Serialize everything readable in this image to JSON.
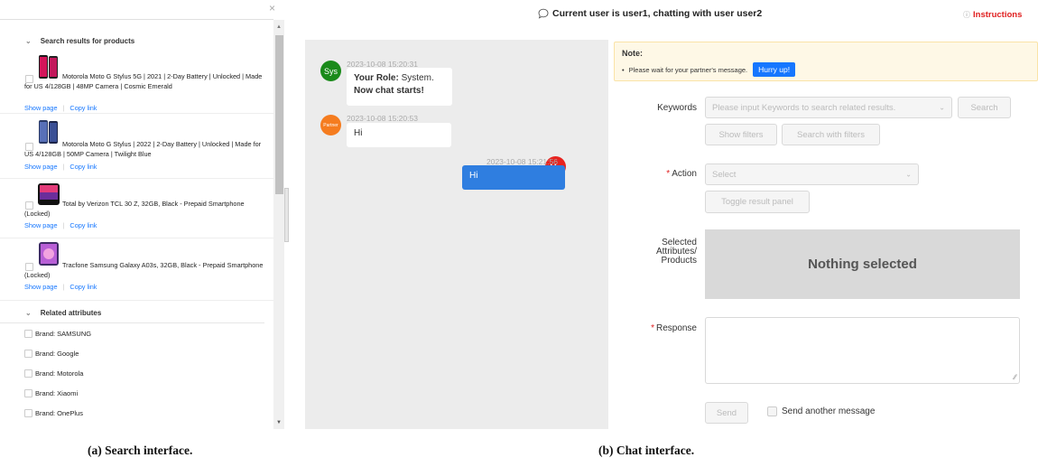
{
  "left": {
    "close_glyph": "×",
    "section_products": "Search results for products",
    "products": [
      {
        "title": "Motorola Moto G Stylus 5G | 2021 | 2-Day Battery | Unlocked | Made for US 4/128GB | 48MP Camera | Cosmic Emerald",
        "show": "Show page",
        "copy": "Copy link"
      },
      {
        "title": "Motorola Moto G Stylus | 2022 | 2-Day Battery | Unlocked | Made for US 4/128GB | 50MP Camera | Twilight Blue",
        "show": "Show page",
        "copy": "Copy link"
      },
      {
        "title": "Total by Verizon TCL 30 Z, 32GB, Black - Prepaid Smartphone (Locked)",
        "show": "Show page",
        "copy": "Copy link"
      },
      {
        "title": "Tracfone Samsung Galaxy A03s, 32GB, Black - Prepaid Smartphone (Locked)",
        "show": "Show page",
        "copy": "Copy link"
      }
    ],
    "section_attributes": "Related attributes",
    "attributes": [
      "Brand: SAMSUNG",
      "Brand: Google",
      "Brand: Motorola",
      "Brand: Xiaomi",
      "Brand: OnePlus"
    ]
  },
  "header": {
    "title": "Current user is user1, chatting with user user2",
    "instructions": "Instructions"
  },
  "chat": {
    "messages": [
      {
        "avatar": "Sys",
        "avatar_color": "#1a8a1a",
        "time": "2023-10-08 15:20:31",
        "role_label": "Your Role:",
        "role_value": "System.",
        "line2": "Now chat starts!"
      },
      {
        "avatar": "Partner",
        "avatar_color": "#f57c1f",
        "time": "2023-10-08 15:20:53",
        "text": "Hi"
      },
      {
        "avatar": "Me",
        "avatar_color": "#e8231f",
        "time": "2023-10-08 15:21:56",
        "text": "Hi"
      }
    ]
  },
  "note": {
    "title": "Note:",
    "body": "Please wait for your partner's message.",
    "button": "Hurry up!"
  },
  "form": {
    "keywords_label": "Keywords",
    "keywords_placeholder": "Please input Keywords to search related results.",
    "search_btn": "Search",
    "show_filters_btn": "Show filters",
    "search_filters_btn": "Search with filters",
    "action_label": "Action",
    "action_placeholder": "Select",
    "toggle_btn": "Toggle result panel",
    "selected_label_1": "Selected",
    "selected_label_2": "Attributes/",
    "selected_label_3": "Products",
    "nothing_selected": "Nothing selected",
    "response_label": "Response",
    "send_btn": "Send",
    "send_another": "Send another message"
  },
  "captions": {
    "a": "(a) Search interface.",
    "b": "(b) Chat interface."
  },
  "colors": {
    "accent": "#1677ff",
    "chat_bg": "#ececec",
    "mine_bubble": "#2f7ee0",
    "required": "#e02020"
  }
}
